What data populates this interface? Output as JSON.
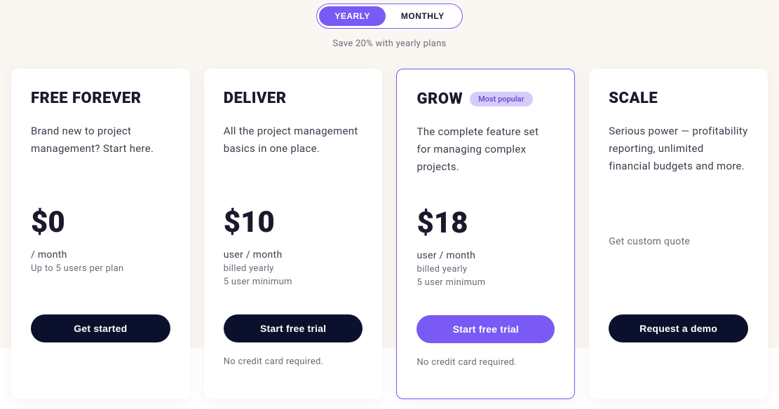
{
  "period_toggle": {
    "yearly": "YEARLY",
    "monthly": "MONTHLY"
  },
  "savings_hint": "Save 20% with yearly plans",
  "plans": [
    {
      "name": "Free Forever",
      "description": "Brand new to project management? Start here.",
      "price": "$0",
      "price_subtitle": "/ month",
      "price_detail1": "Up to 5 users per plan",
      "cta_label": "Get started"
    },
    {
      "name": "Deliver",
      "description": "All the project management basics in one place.",
      "price": "$10",
      "price_subtitle": "user / month",
      "price_detail1": "billed yearly",
      "price_detail2": "5 user minimum",
      "cta_label": "Start free trial",
      "cta_sub": "No credit card required."
    },
    {
      "name": "Grow",
      "badge": "Most popular",
      "description": "The complete feature set for managing complex projects.",
      "price": "$18",
      "price_subtitle": "user / month",
      "price_detail1": "billed yearly",
      "price_detail2": "5 user minimum",
      "cta_label": "Start free trial",
      "cta_sub": "No credit card required."
    },
    {
      "name": "Scale",
      "description": "Serious power — profitability reporting, unlimited financial budgets and more.",
      "custom_quote": "Get custom quote",
      "cta_label": "Request a demo"
    }
  ]
}
